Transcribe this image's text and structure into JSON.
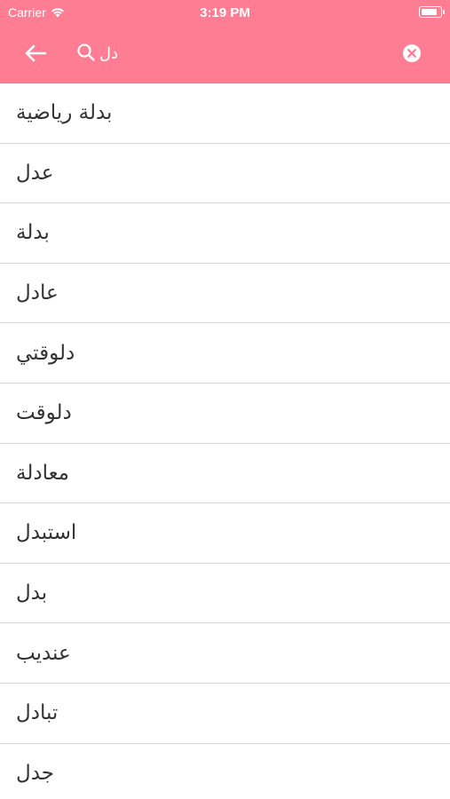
{
  "status_bar": {
    "carrier": "Carrier",
    "time": "3:19 PM"
  },
  "search": {
    "query": "دل"
  },
  "results": [
    "بدلة رياضية",
    "عدل",
    "بدلة",
    "عادل",
    "دلوقتي",
    "دلوقت",
    "معادلة",
    "استبدل",
    "بدل",
    "عنديب",
    "تبادل",
    "جدل"
  ],
  "colors": {
    "header": "#fe7d92",
    "divider": "#d4d4d4",
    "text": "#333333"
  },
  "icons": {
    "back": "arrow-left-icon",
    "search": "search-icon",
    "clear": "clear-circle-icon",
    "wifi": "wifi-icon",
    "battery": "battery-icon"
  }
}
